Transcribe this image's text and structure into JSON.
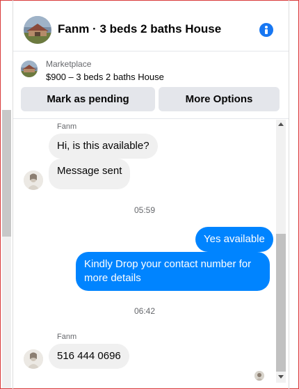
{
  "header": {
    "title": "Fanm · 3 beds 2 baths House"
  },
  "marketplace": {
    "label": "Marketplace",
    "listing": "$900 – 3 beds 2 baths House",
    "mark_pending_label": "Mark as pending",
    "more_options_label": "More Options"
  },
  "conversation": {
    "messages": [
      {
        "sender": "Fanm",
        "text": "Hi, is this available?",
        "direction": "incoming"
      },
      {
        "text": "Message sent",
        "direction": "incoming"
      },
      {
        "timestamp": "05:59"
      },
      {
        "text": "Yes available",
        "direction": "outgoing"
      },
      {
        "text": "Kindly Drop your contact number for more details",
        "direction": "outgoing"
      },
      {
        "timestamp": "06:42"
      },
      {
        "sender": "Fanm",
        "text": "516 444 0696",
        "direction": "incoming"
      }
    ]
  },
  "colors": {
    "accent": "#0084ff",
    "incoming_bubble": "#f0f0f0",
    "button_bg": "#e4e6eb",
    "info_icon": "#1877f2"
  },
  "icons": [
    "info-icon",
    "scroll-up-arrow",
    "scroll-down-arrow"
  ]
}
